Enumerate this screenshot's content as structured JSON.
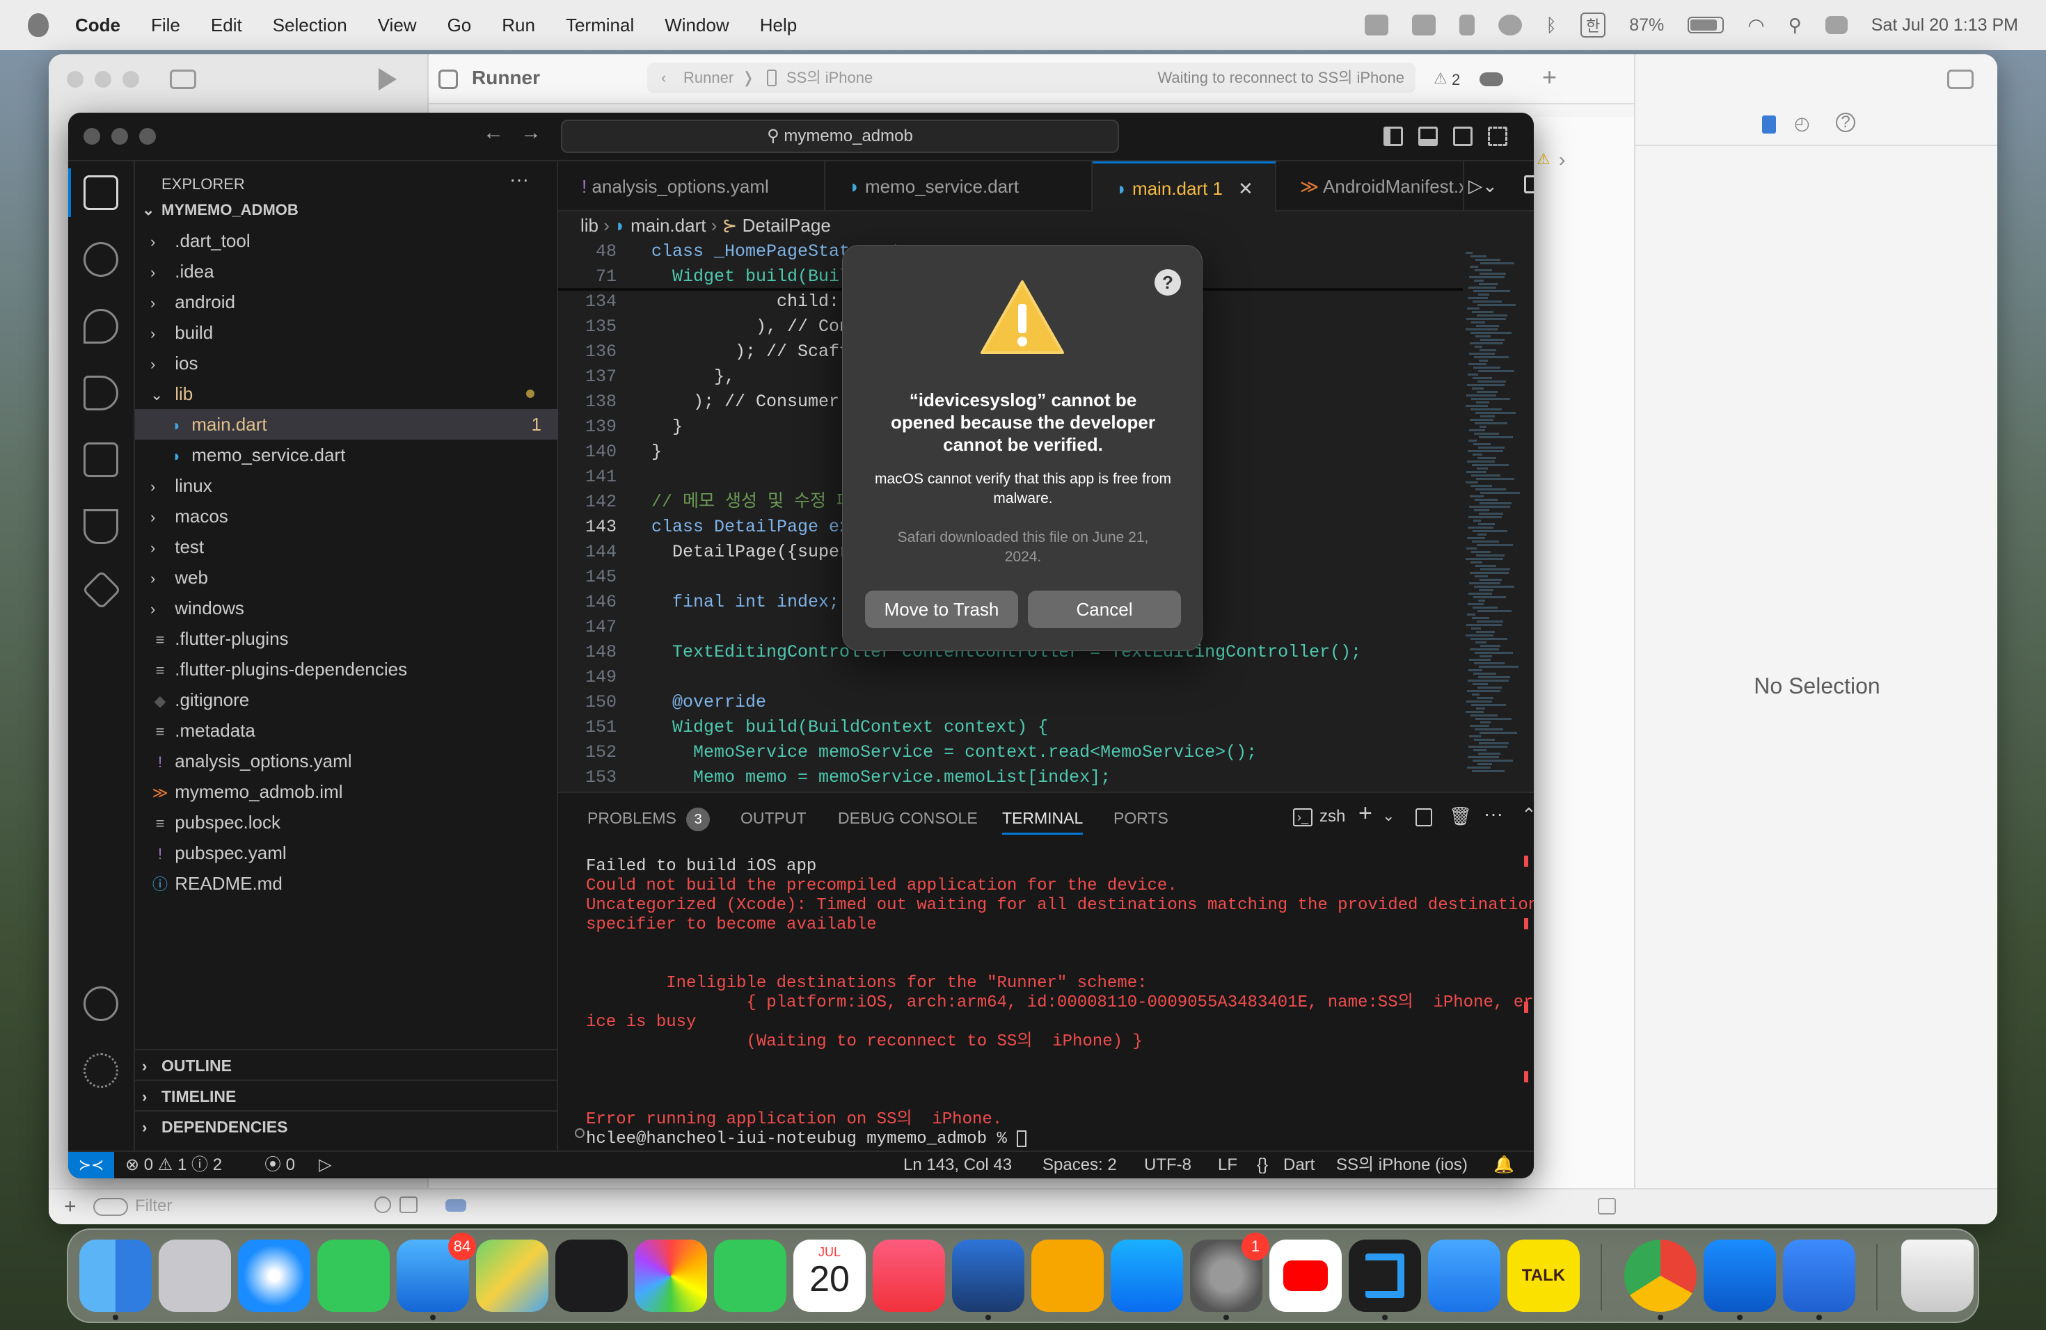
{
  "menubar": {
    "app": "Code",
    "items": [
      "File",
      "Edit",
      "Selection",
      "View",
      "Go",
      "Run",
      "Terminal",
      "Window",
      "Help"
    ],
    "battery": "87%",
    "datetime": "Sat Jul 20  1:13 PM"
  },
  "xcode": {
    "scheme": "Runner",
    "breadcrumb_scheme": "Runner",
    "breadcrumb_device": "SS의 iPhone",
    "status": "Waiting to reconnect to SS의 iPhone",
    "warning_count": "2",
    "inspector_text": "No Selection",
    "filter_placeholder": "Filter"
  },
  "vscode": {
    "search": "mymemo_admob",
    "explorer_title": "EXPLORER",
    "project": "MYMEMO_ADMOB",
    "tree": [
      {
        "label": ".dart_tool",
        "type": "folder"
      },
      {
        "label": ".idea",
        "type": "folder"
      },
      {
        "label": "android",
        "type": "folder"
      },
      {
        "label": "build",
        "type": "folder"
      },
      {
        "label": "ios",
        "type": "folder"
      },
      {
        "label": "lib",
        "type": "folder-open"
      },
      {
        "label": "main.dart",
        "type": "dart",
        "badge": "1"
      },
      {
        "label": "memo_service.dart",
        "type": "dart"
      },
      {
        "label": "linux",
        "type": "folder"
      },
      {
        "label": "macos",
        "type": "folder"
      },
      {
        "label": "test",
        "type": "folder"
      },
      {
        "label": "web",
        "type": "folder"
      },
      {
        "label": "windows",
        "type": "folder"
      },
      {
        "label": ".flutter-plugins",
        "type": "file"
      },
      {
        "label": ".flutter-plugins-dependencies",
        "type": "file"
      },
      {
        "label": ".gitignore",
        "type": "git"
      },
      {
        "label": ".metadata",
        "type": "file"
      },
      {
        "label": "analysis_options.yaml",
        "type": "yaml"
      },
      {
        "label": "mymemo_admob.iml",
        "type": "xml"
      },
      {
        "label": "pubspec.lock",
        "type": "file"
      },
      {
        "label": "pubspec.yaml",
        "type": "yaml"
      },
      {
        "label": "README.md",
        "type": "info"
      }
    ],
    "sections": [
      "OUTLINE",
      "TIMELINE",
      "DEPENDENCIES"
    ],
    "tabs": [
      {
        "label": "analysis_options.yaml",
        "icon": "!"
      },
      {
        "label": "memo_service.dart",
        "icon": "◗"
      },
      {
        "label": "main.dart 1",
        "icon": "◗"
      },
      {
        "label": "AndroidManifest.xn",
        "icon": "≫"
      }
    ],
    "crumbs": [
      "lib",
      "main.dart",
      "DetailPage"
    ],
    "code": [
      {
        "n": "48",
        "t": "class _HomePageState exten"
      },
      {
        "n": "71",
        "t": "  Widget build(BuildContex"
      },
      {
        "n": "134",
        "t": "            child: AdWidge"
      },
      {
        "n": "135",
        "t": "          ), // Container"
      },
      {
        "n": "136",
        "t": "        ); // Scaffold"
      },
      {
        "n": "137",
        "t": "      },"
      },
      {
        "n": "138",
        "t": "    ); // Consumer"
      },
      {
        "n": "139",
        "t": "  }"
      },
      {
        "n": "140",
        "t": "}"
      },
      {
        "n": "141",
        "t": ""
      },
      {
        "n": "142",
        "t": "// 메모 생성 및 수정 페이지"
      },
      {
        "n": "143",
        "t": "class DetailPage extends S"
      },
      {
        "n": "144",
        "t": "  DetailPage({super.key, r"
      },
      {
        "n": "145",
        "t": ""
      },
      {
        "n": "146",
        "t": "  final int index;"
      },
      {
        "n": "147",
        "t": ""
      },
      {
        "n": "148",
        "t": "  TextEditingController contentController = TextEditingController();"
      },
      {
        "n": "149",
        "t": ""
      },
      {
        "n": "150",
        "t": "  @override"
      },
      {
        "n": "151",
        "t": "  Widget build(BuildContext context) {"
      },
      {
        "n": "152",
        "t": "    MemoService memoService = context.read<MemoService>();"
      },
      {
        "n": "153",
        "t": "    Memo memo = memoService.memoList[index];"
      }
    ],
    "panel_tabs": [
      "PROBLEMS",
      "OUTPUT",
      "DEBUG CONSOLE",
      "TERMINAL",
      "PORTS"
    ],
    "problems_count": "3",
    "shell": "zsh",
    "terminal": [
      {
        "t": "Failed to build iOS app",
        "c": "#d4d4d4"
      },
      {
        "t": "Could not build the precompiled application for the device.",
        "c": "#f14c4c"
      },
      {
        "t": "Uncategorized (Xcode): Timed out waiting for all destinations matching the provided destination",
        "c": "#f14c4c"
      },
      {
        "t": "specifier to become available",
        "c": "#f14c4c"
      },
      {
        "t": "",
        "c": "#f14c4c"
      },
      {
        "t": "",
        "c": "#f14c4c"
      },
      {
        "t": "        Ineligible destinations for the \"Runner\" scheme:",
        "c": "#f14c4c"
      },
      {
        "t": "                { platform:iOS, arch:arm64, id:00008110-0009055A3483401E, name:SS의  iPhone, error:Dev",
        "c": "#f14c4c"
      },
      {
        "t": "ice is busy",
        "c": "#f14c4c"
      },
      {
        "t": "                (Waiting to reconnect to SS의  iPhone) }",
        "c": "#f14c4c"
      },
      {
        "t": "",
        "c": "#f14c4c"
      },
      {
        "t": "",
        "c": "#f14c4c"
      },
      {
        "t": "",
        "c": "#f14c4c"
      },
      {
        "t": "Error running application on SS의  iPhone.",
        "c": "#f14c4c"
      },
      {
        "t": "hclee@hancheol-iui-noteubug mymemo_admob % ",
        "c": "#d4d4d4"
      }
    ],
    "status": {
      "errors": "0",
      "warnings": "1",
      "infos": "2",
      "ports": "0",
      "position": "Ln 143, Col 43",
      "spaces": "Spaces: 2",
      "encoding": "UTF-8",
      "eol": "LF",
      "language": "Dart",
      "device": "SS의 iPhone (ios)"
    }
  },
  "dialog": {
    "title": "“idevicesyslog” cannot be opened because the developer cannot be verified.",
    "body": "macOS cannot verify that this app is free from malware.",
    "footnote": "Safari downloaded this file on June 21, 2024.",
    "primary": "Move to Trash",
    "secondary": "Cancel",
    "help": "?"
  },
  "dock": {
    "mail_badge": "84",
    "settings_badge": "1",
    "calendar_month": "JUL",
    "calendar_day": "20",
    "talk": "TALK"
  }
}
